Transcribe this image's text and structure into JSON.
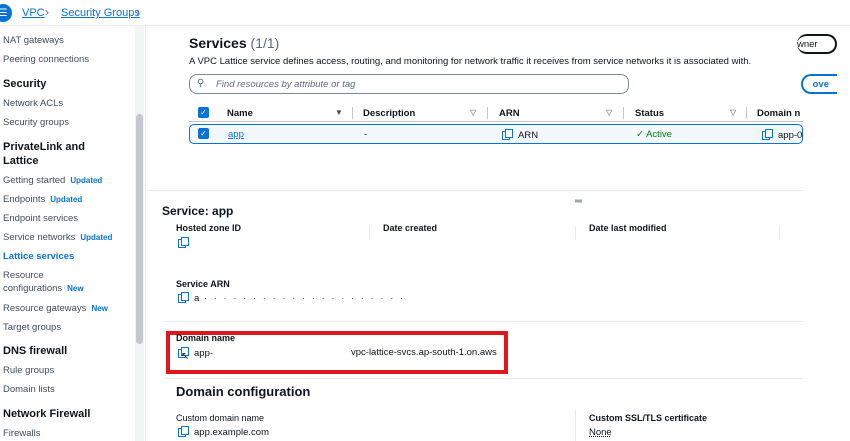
{
  "breadcrumb": {
    "items": [
      "VPC",
      "Security Groups"
    ]
  },
  "sidebar": {
    "items": [
      {
        "type": "item",
        "label": "NAT gateways"
      },
      {
        "type": "item",
        "label": "Peering connections"
      },
      {
        "type": "head",
        "label": "Security"
      },
      {
        "type": "item",
        "label": "Network ACLs"
      },
      {
        "type": "item",
        "label": "Security groups"
      },
      {
        "type": "head",
        "label": "PrivateLink and"
      },
      {
        "type": "head",
        "label": "Lattice"
      },
      {
        "type": "item",
        "label": "Getting started",
        "badge": "Updated"
      },
      {
        "type": "item",
        "label": "Endpoints",
        "badge": "Updated"
      },
      {
        "type": "item",
        "label": "Endpoint services"
      },
      {
        "type": "item",
        "label": "Service networks",
        "badge": "Updated"
      },
      {
        "type": "active",
        "label": "Lattice services"
      },
      {
        "type": "item",
        "label": "Resource"
      },
      {
        "type": "item",
        "label": "configurations",
        "badge": "New"
      },
      {
        "type": "item",
        "label": "Resource gateways",
        "badge": "New"
      },
      {
        "type": "item",
        "label": "Target groups"
      },
      {
        "type": "head",
        "label": "DNS firewall"
      },
      {
        "type": "item",
        "label": "Rule groups"
      },
      {
        "type": "item",
        "label": "Domain lists"
      },
      {
        "type": "head",
        "label": "Network Firewall"
      },
      {
        "type": "item",
        "label": "Firewalls"
      }
    ]
  },
  "services": {
    "title": "Services",
    "count": "(1/1)",
    "description": "A VPC Lattice service defines access, routing, and monitoring for network traffic it receives from service networks it is associated with.",
    "search_placeholder": "Find resources by attribute or tag",
    "owner_button": "wner",
    "remove_button": "ove",
    "columns": [
      "Name",
      "Description",
      "ARN",
      "Status",
      "Domain n"
    ],
    "row": {
      "name": "app",
      "description": "-",
      "arn": "ARN",
      "status": "Active",
      "domain": "app-0"
    }
  },
  "service_detail": {
    "title": "Service: app",
    "hosted_zone_label": "Hosted zone ID",
    "date_created_label": "Date created",
    "date_modified_label": "Date last modified",
    "service_arn_label": "Service ARN",
    "service_arn_value": "a",
    "domain_name_label": "Domain name",
    "domain_name_prefix": "app-",
    "domain_name_suffix": "vpc-lattice-svcs.ap-south-1.on.aws",
    "domain_config_title": "Domain configuration",
    "custom_domain_label": "Custom domain name",
    "custom_domain_value": "app.example.com",
    "ssl_label": "Custom SSL/TLS certificate",
    "ssl_value": "None"
  },
  "colors": {
    "accent": "#0972d3",
    "success": "#037f0c",
    "highlight": "#e0161f"
  }
}
